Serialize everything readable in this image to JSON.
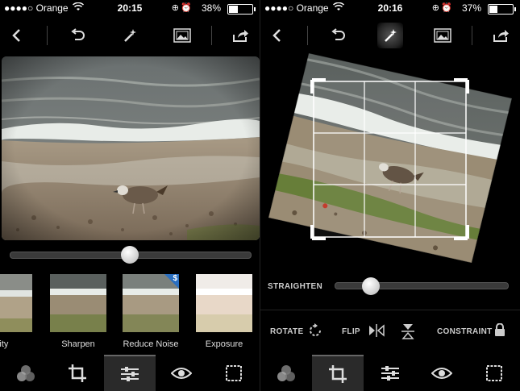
{
  "left": {
    "status": {
      "carrier": "●●●●○ Orange",
      "time": "20:15",
      "battery": "38%",
      "battery_level": 0.38
    },
    "slider_value": 0.5,
    "thumbnails": [
      {
        "label": "arity",
        "badge": ""
      },
      {
        "label": "Sharpen",
        "badge": ""
      },
      {
        "label": "Reduce Noise",
        "badge": "$"
      },
      {
        "label": "Exposure",
        "badge": ""
      }
    ]
  },
  "right": {
    "status": {
      "carrier": "●●●●○ Orange",
      "time": "20:16",
      "battery": "37%",
      "battery_level": 0.37
    },
    "straighten_label": "STRAIGHTEN",
    "straighten_value": 0.21,
    "rotate_label": "ROTATE",
    "flip_label": "FLIP",
    "constraint_label": "CONSTRAINT"
  },
  "icons": {
    "back": "chevron-left-icon",
    "undo": "undo-icon",
    "auto": "magic-wand-icon",
    "gallery": "image-icon",
    "share": "share-icon",
    "color": "color-circles-icon",
    "crop": "crop-icon",
    "adjust": "sliders-icon",
    "view": "eye-icon",
    "frame": "frame-icon"
  }
}
